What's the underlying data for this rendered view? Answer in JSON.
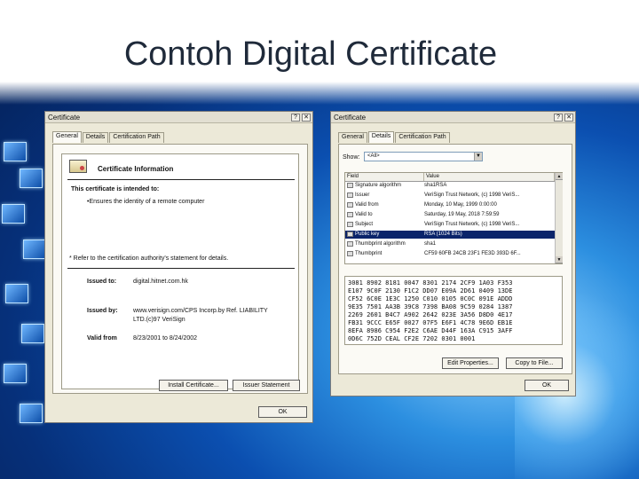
{
  "slide": {
    "title": "Contoh Digital Certificate"
  },
  "left_dialog": {
    "title": "Certificate",
    "help": "?",
    "close": "✕",
    "tabs": [
      "General",
      "Details",
      "Certification Path"
    ],
    "info_heading": "Certificate Information",
    "intended_heading": "This certificate is intended to:",
    "intended_item": "•Ensures the identity of a remote computer",
    "note": "* Refer to the certification authority's statement for details.",
    "issued_to_label": "Issued to:",
    "issued_to_value": "digital.hitnet.com.hk",
    "issued_by_label": "Issued by:",
    "issued_by_value_1": "www.verisign.com/CPS Incorp.by Ref. LIABILITY",
    "issued_by_value_2": "LTD.(c)97 VeriSign",
    "valid_from_label": "Valid from",
    "valid_from_value": "8/23/2001  to  8/24/2002",
    "install_button": "Install Certificate...",
    "issuer_button": "Issuer Statement",
    "ok_button": "OK"
  },
  "right_dialog": {
    "title": "Certificate",
    "help": "?",
    "close": "✕",
    "tabs": [
      "General",
      "Details",
      "Certification Path"
    ],
    "show_label": "Show:",
    "show_value": "<All>",
    "columns": [
      "Field",
      "Value"
    ],
    "rows": [
      {
        "field": "Signature algorithm",
        "value": "sha1RSA"
      },
      {
        "field": "Issuer",
        "value": "VeriSign Trust Network, (c) 1998 VeriS..."
      },
      {
        "field": "Valid from",
        "value": "Monday, 10 May, 1999 0:00:00"
      },
      {
        "field": "Valid to",
        "value": "Saturday, 19 May, 2018 7:59:59"
      },
      {
        "field": "Subject",
        "value": "VeriSign Trust Network, (c) 1998 VeriS..."
      },
      {
        "field": "Public key",
        "value": "RSA (1024 Bits)"
      },
      {
        "field": "Thumbprint algorithm",
        "value": "sha1"
      },
      {
        "field": "Thumbprint",
        "value": "CF59 60FB 24CB 23F1 FE3D 393D 6F..."
      }
    ],
    "hex_lines": [
      "3081 8902 8181 0047 8301 2174 2CF9 1A03 F353",
      "E107 9C0F 2130 F1C2 DD07 E09A 2D61 0409 13DE",
      "CF52 6C0E 1E3C 1250 C010 0105 0C0C 091E ADDD",
      "9E35 7501 AA3B 39C8 7398 BA08 9C59 0284 1387",
      "2269 2601 B4C7 A902 2642 023E 3A56 D8D0 4E17",
      "FB31 9CCC E65F 0027 07F5 E6F1 4C78 9E6D EB1E",
      "8EFA 8986 C954 F2E2 C6AE D44F 163A C915 3AFF",
      "0D6C 752D CEAL CF2E 7202 0301 0001"
    ],
    "edit_button": "Edit Properties...",
    "copy_button": "Copy to File...",
    "ok_button": "OK"
  }
}
